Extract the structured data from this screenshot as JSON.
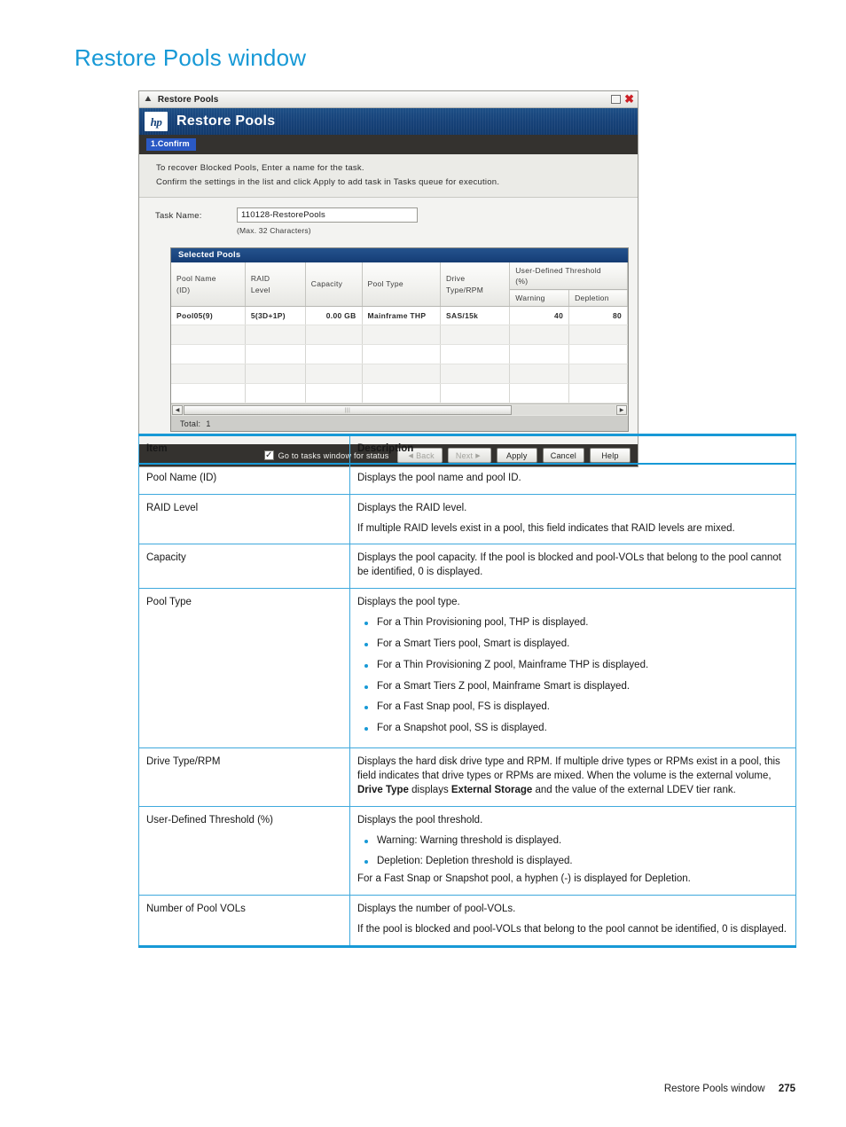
{
  "page": {
    "title": "Restore Pools window",
    "footer_label": "Restore Pools window",
    "footer_page": "275"
  },
  "dialog": {
    "window_title": "Restore Pools",
    "collapse_icon": "chevron-up-icon",
    "maximize_icon": "maximize-icon",
    "close_icon": "close-icon",
    "brand_logo": "hp-logo",
    "brand_logo_text": "hp",
    "product_title": "Restore Pools",
    "step": "1.Confirm",
    "instructions": [
      "To recover Blocked Pools, Enter a name for the task.",
      "Confirm the settings in the list and click Apply to add task in Tasks queue for execution."
    ],
    "task": {
      "label": "Task Name:",
      "value": "110128-RestorePools",
      "placeholder": "",
      "hint": "(Max. 32 Characters)"
    },
    "pools_panel": {
      "header": "Selected Pools",
      "columns": [
        "Pool Name (ID)",
        "RAID Level",
        "Capacity",
        "Pool Type",
        "Drive Type/RPM",
        "User-Defined Threshold (%)"
      ],
      "column_parts": {
        "pool_name_l1": "Pool Name",
        "pool_name_l2": "(ID)",
        "raid_l1": "RAID",
        "raid_l2": "Level",
        "capacity": "Capacity",
        "pool_type": "Pool Type",
        "drive_l1": "Drive",
        "drive_l2": "Type/RPM",
        "threshold_l1": "User-Defined Threshold",
        "threshold_l2": "(%)",
        "warning": "Warning",
        "depletion": "Depletion"
      },
      "rows": [
        {
          "pool_name": "Pool05(9)",
          "raid_level": "5(3D+1P)",
          "capacity": "0.00 GB",
          "pool_type": "Mainframe THP",
          "drive_type_rpm": "SAS/15k",
          "warning": "40",
          "depletion": "80"
        }
      ],
      "empty_row_count": 4,
      "total_label": "Total:",
      "total_value": "1",
      "scroll_left_icon": "arrow-left-icon",
      "scroll_right_icon": "arrow-right-icon"
    },
    "footer": {
      "checkbox_label": "Go to tasks window for status",
      "checkbox_checked": true,
      "back_label": "Back",
      "next_label": "Next",
      "apply_label": "Apply",
      "cancel_label": "Cancel",
      "help_label": "Help"
    }
  },
  "reference": {
    "headers": {
      "item": "Item",
      "description": "Description"
    },
    "rows": [
      {
        "item": "Pool Name (ID)",
        "paras": [
          "Displays the pool name and pool ID."
        ],
        "bullets": [],
        "tail": ""
      },
      {
        "item": "RAID Level",
        "paras": [
          "Displays the RAID level.",
          "If multiple RAID levels exist in a pool, this field indicates that RAID levels are mixed."
        ],
        "bullets": [],
        "tail": ""
      },
      {
        "item": "Capacity",
        "paras": [
          "Displays the pool capacity. If the pool is blocked and pool-VOLs that belong to the pool cannot be identified, 0 is displayed."
        ],
        "bullets": [],
        "tail": ""
      },
      {
        "item": "Pool Type",
        "paras": [
          "Displays the pool type."
        ],
        "bullets": [
          "For a Thin Provisioning pool, THP is displayed.",
          "For a Smart Tiers pool, Smart is displayed.",
          "For a Thin Provisioning Z pool, Mainframe THP is displayed.",
          "For a Smart Tiers Z pool, Mainframe Smart is displayed.",
          "For a Fast Snap pool, FS is displayed.",
          "For a Snapshot pool, SS is displayed."
        ],
        "tail": ""
      },
      {
        "item": "Drive Type/RPM",
        "paras": [],
        "bullets": [],
        "tail": "",
        "rich": true
      },
      {
        "item": "User-Defined Threshold (%)",
        "paras": [
          "Displays the pool threshold."
        ],
        "bullets": [
          "Warning: Warning threshold is displayed.",
          "Depletion: Depletion threshold is displayed."
        ],
        "tail": "For a Fast Snap or Snapshot pool, a hyphen (-) is displayed for Depletion."
      },
      {
        "item": "Number of Pool VOLs",
        "paras": [
          "Displays the number of pool-VOLs.",
          "If the pool is blocked and pool-VOLs that belong to the pool cannot be identified, 0 is displayed."
        ],
        "bullets": [],
        "tail": ""
      }
    ],
    "drive_type_rpm_text": {
      "part1": "Displays the hard disk drive type and RPM. If multiple drive types or RPMs exist in a pool, this field indicates that drive types or RPMs are mixed. When the volume is the external volume, ",
      "bold1": "Drive Type",
      "part2": " displays ",
      "bold2": "External Storage",
      "part3": " and the value of the external LDEV tier rank."
    }
  },
  "colors": {
    "accent": "#1799d6",
    "table_border": "#3fa9dd",
    "banner_blue": "#17437a",
    "step_chip": "#2a59c4",
    "dark_bar": "#34322f",
    "close_red": "#cc2026"
  }
}
